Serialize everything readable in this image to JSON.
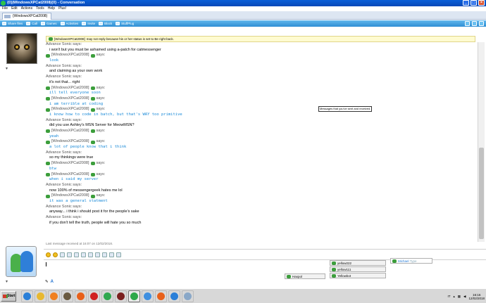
{
  "window": {
    "title": "{0}|WindowsXPCat2008|{0} - Conversation",
    "buttons": [
      "_",
      "□",
      "×"
    ]
  },
  "menubar": [
    "File",
    "Edit",
    "Actions",
    "Tools",
    "Help",
    "Plus!"
  ],
  "tab": {
    "label": "{WindowsXPCat2008}"
  },
  "toolbar": {
    "items": [
      {
        "label": "Share files",
        "icon": "share-files-icon"
      },
      {
        "label": "Call",
        "icon": "phone-icon"
      },
      {
        "label": "Games",
        "icon": "games-icon"
      },
      {
        "label": "Activities",
        "icon": "activities-icon"
      },
      {
        "label": "Invite",
        "icon": "invite-icon"
      },
      {
        "label": "Block",
        "icon": "block-icon"
      },
      {
        "label": "StuffPlug",
        "icon": "stuffplug-icon"
      }
    ]
  },
  "infobar": {
    "name": "[WindowsXPCat2008]",
    "text": "may not reply because his or her status is set to Be right back."
  },
  "conversation": [
    {
      "from": "Advance Sonic says:",
      "who": "other",
      "lines": [
        "i won't but you must be ashamed using a-patch for catmessenger"
      ]
    },
    {
      "from": "[WindowsXPCat2008]",
      "who": "me",
      "lines": [
        "look"
      ]
    },
    {
      "from": "Advance Sonic says:",
      "who": "other",
      "lines": [
        "and claiming as your own work"
      ]
    },
    {
      "from": "Advance Sonic says:",
      "who": "other",
      "lines": [
        "it's not that... right"
      ]
    },
    {
      "from": "[WindowsXPCat2008]",
      "who": "me",
      "lines": [
        "ill tell everyone soon"
      ]
    },
    {
      "from": "[WindowsXPCat2008]",
      "who": "me",
      "lines": [
        "i am terrible at coding"
      ]
    },
    {
      "from": "[WindowsXPCat2008]",
      "who": "me",
      "lines": [
        "i know how to code in batch, but that's WAY too primitive"
      ]
    },
    {
      "from": "Advance Sonic says:",
      "who": "other",
      "lines": [
        "did you use Ashley's MSN Server for MeowMSN?"
      ]
    },
    {
      "from": "[WindowsXPCat2008]",
      "who": "me",
      "lines": [
        "yeah"
      ]
    },
    {
      "from": "[WindowsXPCat2008]",
      "who": "me",
      "lines": [
        "a lot of people know that i think"
      ]
    },
    {
      "from": "Advance Sonic says:",
      "who": "other",
      "lines": [
        "so my thinkings were true"
      ]
    },
    {
      "from": "[WindowsXPCat2008]",
      "who": "me",
      "lines": [
        "btw"
      ]
    },
    {
      "from": "[WindowsXPCat2008]",
      "who": "me",
      "lines": [
        "when i said my server"
      ]
    },
    {
      "from": "Advance Sonic says:",
      "who": "other",
      "lines": [
        "now 100% of messengergeek hates me lol"
      ]
    },
    {
      "from": "[WindowsXPCat2008]",
      "who": "me",
      "lines": [
        "it was a general statment"
      ]
    },
    {
      "from": "Advance Sonic says:",
      "who": "other",
      "lines": [
        "anyway... i think i should post it for the people's sake"
      ]
    },
    {
      "from": "Advance Sonic says:",
      "who": "other",
      "lines": [
        "if you don't tell the truth, people will hate you so much"
      ]
    }
  ],
  "says_suffix": "says:",
  "tooltip": "Messages that you've sent and received.",
  "last_message": "Last message received at 16:07 on 12/02/2018.",
  "input": {
    "value": ""
  },
  "participants": [
    {
      "name": "Haxpol",
      "status": "online"
    },
    {
      "name": "yellow222",
      "status": "online"
    },
    {
      "name": "yellow111",
      "status": "online"
    },
    {
      "name": "Yellowbot",
      "status": "online"
    },
    {
      "name": "Michael",
      "extra": "Type"
    }
  ],
  "taskbar": {
    "start": "Start",
    "lang": "IT",
    "time": "16:16",
    "date": "12/02/2018",
    "apps": [
      {
        "icon": "ie-icon",
        "color": "#2a7fd8"
      },
      {
        "icon": "folder-icon",
        "color": "#e8b830"
      },
      {
        "icon": "media-player-icon",
        "color": "#f08020"
      },
      {
        "icon": "game-icon",
        "color": "#6a5a40"
      },
      {
        "icon": "firefox-icon",
        "color": "#e8601a"
      },
      {
        "icon": "opera-icon",
        "color": "#d02020"
      },
      {
        "icon": "chrome-icon",
        "color": "#2fa84f"
      },
      {
        "icon": "virtualbox-icon",
        "color": "#7a1f1f"
      },
      {
        "icon": "msn-icon",
        "color": "#2ea84a"
      },
      {
        "icon": "remote-desktop-icon",
        "color": "#3f8fe0"
      },
      {
        "icon": "firefox-icon",
        "color": "#e8601a"
      },
      {
        "icon": "ie-icon",
        "color": "#2a7fd8"
      },
      {
        "icon": "notepad-icon",
        "color": "#8aa8c8"
      }
    ]
  }
}
